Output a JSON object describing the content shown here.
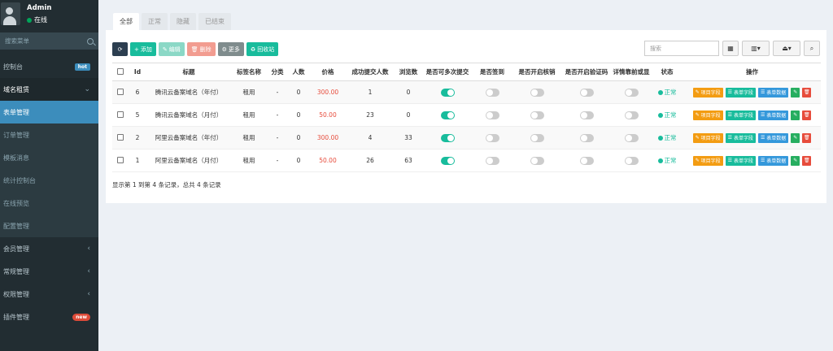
{
  "user": {
    "name": "Admin",
    "status": "在线"
  },
  "sidebar": {
    "search_placeholder": "搜索菜单",
    "items": [
      {
        "label": "控制台",
        "badge": "hot"
      },
      {
        "label": "域名租赁"
      },
      {
        "label": "表单管理"
      },
      {
        "label": "订单管理"
      },
      {
        "label": "模板消息"
      },
      {
        "label": "统计控制台"
      },
      {
        "label": "在线预览"
      },
      {
        "label": "配置管理"
      },
      {
        "label": "会员管理"
      },
      {
        "label": "常规管理"
      },
      {
        "label": "权限管理"
      },
      {
        "label": "插件管理",
        "badge": "new"
      }
    ]
  },
  "tabs": [
    "全部",
    "正常",
    "隐藏",
    "已结束"
  ],
  "toolbar": {
    "add": "添加",
    "edit": "编辑",
    "delete": "删除",
    "more": "更多",
    "recycle": "回收站"
  },
  "search": {
    "placeholder": "搜索"
  },
  "table": {
    "headers": [
      "Id",
      "标题",
      "标签名称",
      "分类",
      "人数",
      "价格",
      "成功提交人数",
      "浏览数",
      "是否可多次提交",
      "是否签到",
      "是否开启核销",
      "是否开启验证码",
      "详情靠前或显",
      "状态",
      "操作"
    ],
    "rows": [
      {
        "id": "6",
        "title": "腾讯云备案域名（年付）",
        "tag": "租用",
        "cat": "-",
        "people": "0",
        "price": "300.00",
        "success": "1",
        "views": "0",
        "multi": true,
        "sign": false,
        "verify": false,
        "captcha": false,
        "detail": false,
        "status": "正常"
      },
      {
        "id": "5",
        "title": "腾讯云备案域名（月付）",
        "tag": "租用",
        "cat": "-",
        "people": "0",
        "price": "50.00",
        "success": "23",
        "views": "0",
        "multi": true,
        "sign": false,
        "verify": false,
        "captcha": false,
        "detail": false,
        "status": "正常"
      },
      {
        "id": "2",
        "title": "阿里云备案域名（年付）",
        "tag": "租用",
        "cat": "-",
        "people": "0",
        "price": "300.00",
        "success": "4",
        "views": "33",
        "multi": true,
        "sign": false,
        "verify": false,
        "captcha": false,
        "detail": false,
        "status": "正常"
      },
      {
        "id": "1",
        "title": "阿里云备案域名（月付）",
        "tag": "租用",
        "cat": "-",
        "people": "0",
        "price": "50.00",
        "success": "26",
        "views": "63",
        "multi": true,
        "sign": false,
        "verify": false,
        "captcha": false,
        "detail": false,
        "status": "正常"
      }
    ],
    "op_labels": {
      "project": "项目字段",
      "form_field": "表单字段",
      "form_data": "表单数据"
    }
  },
  "footer": "显示第 1 到第 4 条记录，总共 4 条记录"
}
